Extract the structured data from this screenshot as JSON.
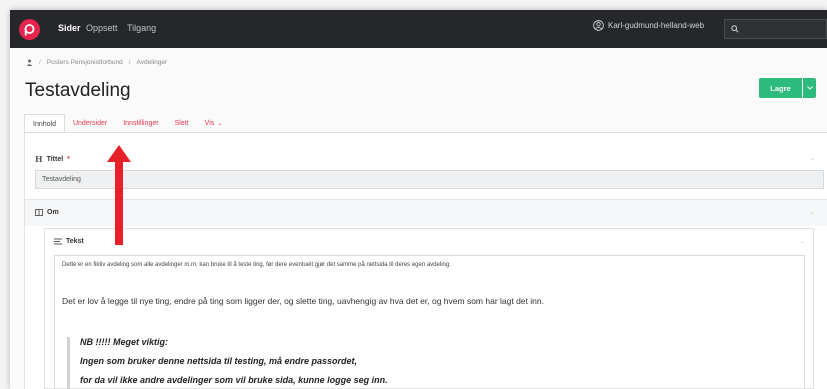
{
  "topnav": {
    "items": [
      "Sider",
      "Oppsett",
      "Tilgang"
    ],
    "active": "Sider",
    "user": "Karl-gudmund-helland-web",
    "search_placeholder": ""
  },
  "breadcrumb": [
    "Posters Pensjonistforbund",
    "Avdelinger"
  ],
  "page": {
    "title": "Testavdeling",
    "save_label": "Lagre"
  },
  "tabs": [
    {
      "label": "Innhold",
      "active": true
    },
    {
      "label": "Undersider",
      "active": false
    },
    {
      "label": "Innstillinger",
      "active": false
    },
    {
      "label": "Slett",
      "active": false
    },
    {
      "label": "Vis",
      "active": false
    }
  ],
  "fields": {
    "title_label": "Tittel",
    "title_required": "*",
    "title_value": "Testavdeling",
    "om_label": "Om",
    "tekst_label": "Tekst"
  },
  "editor": {
    "p1": "Dette er en fiktiv avdeling som alle avdelinger m.m. kan bruke til å teste ting, før dere eventuelt gjør det samme på nettsida til deres egen avdeling.",
    "p2": "Det er lov å legge til nye ting, endre på ting som ligger der, og slette ting, uavhengig av hva det er, og hvem som har lagt det inn.",
    "quote": [
      "NB !!!!!    Meget viktig:",
      "Ingen som bruker denne nettsida til testing, må endre passordet,",
      "for da vil ikke andre avdelinger som vil bruke sida, kunne logge seg inn."
    ]
  },
  "colors": {
    "accent": "#e23a4e",
    "brand": "#e6244d",
    "nav_bg": "#25272a",
    "save": "#2dba7d",
    "arrow": "#e8202a"
  },
  "icons": [
    "logo-icon",
    "user-icon",
    "search-icon",
    "home-icon",
    "heading-icon",
    "columns-icon",
    "text-icon",
    "chevron-down-icon",
    "arrow-annotation"
  ]
}
